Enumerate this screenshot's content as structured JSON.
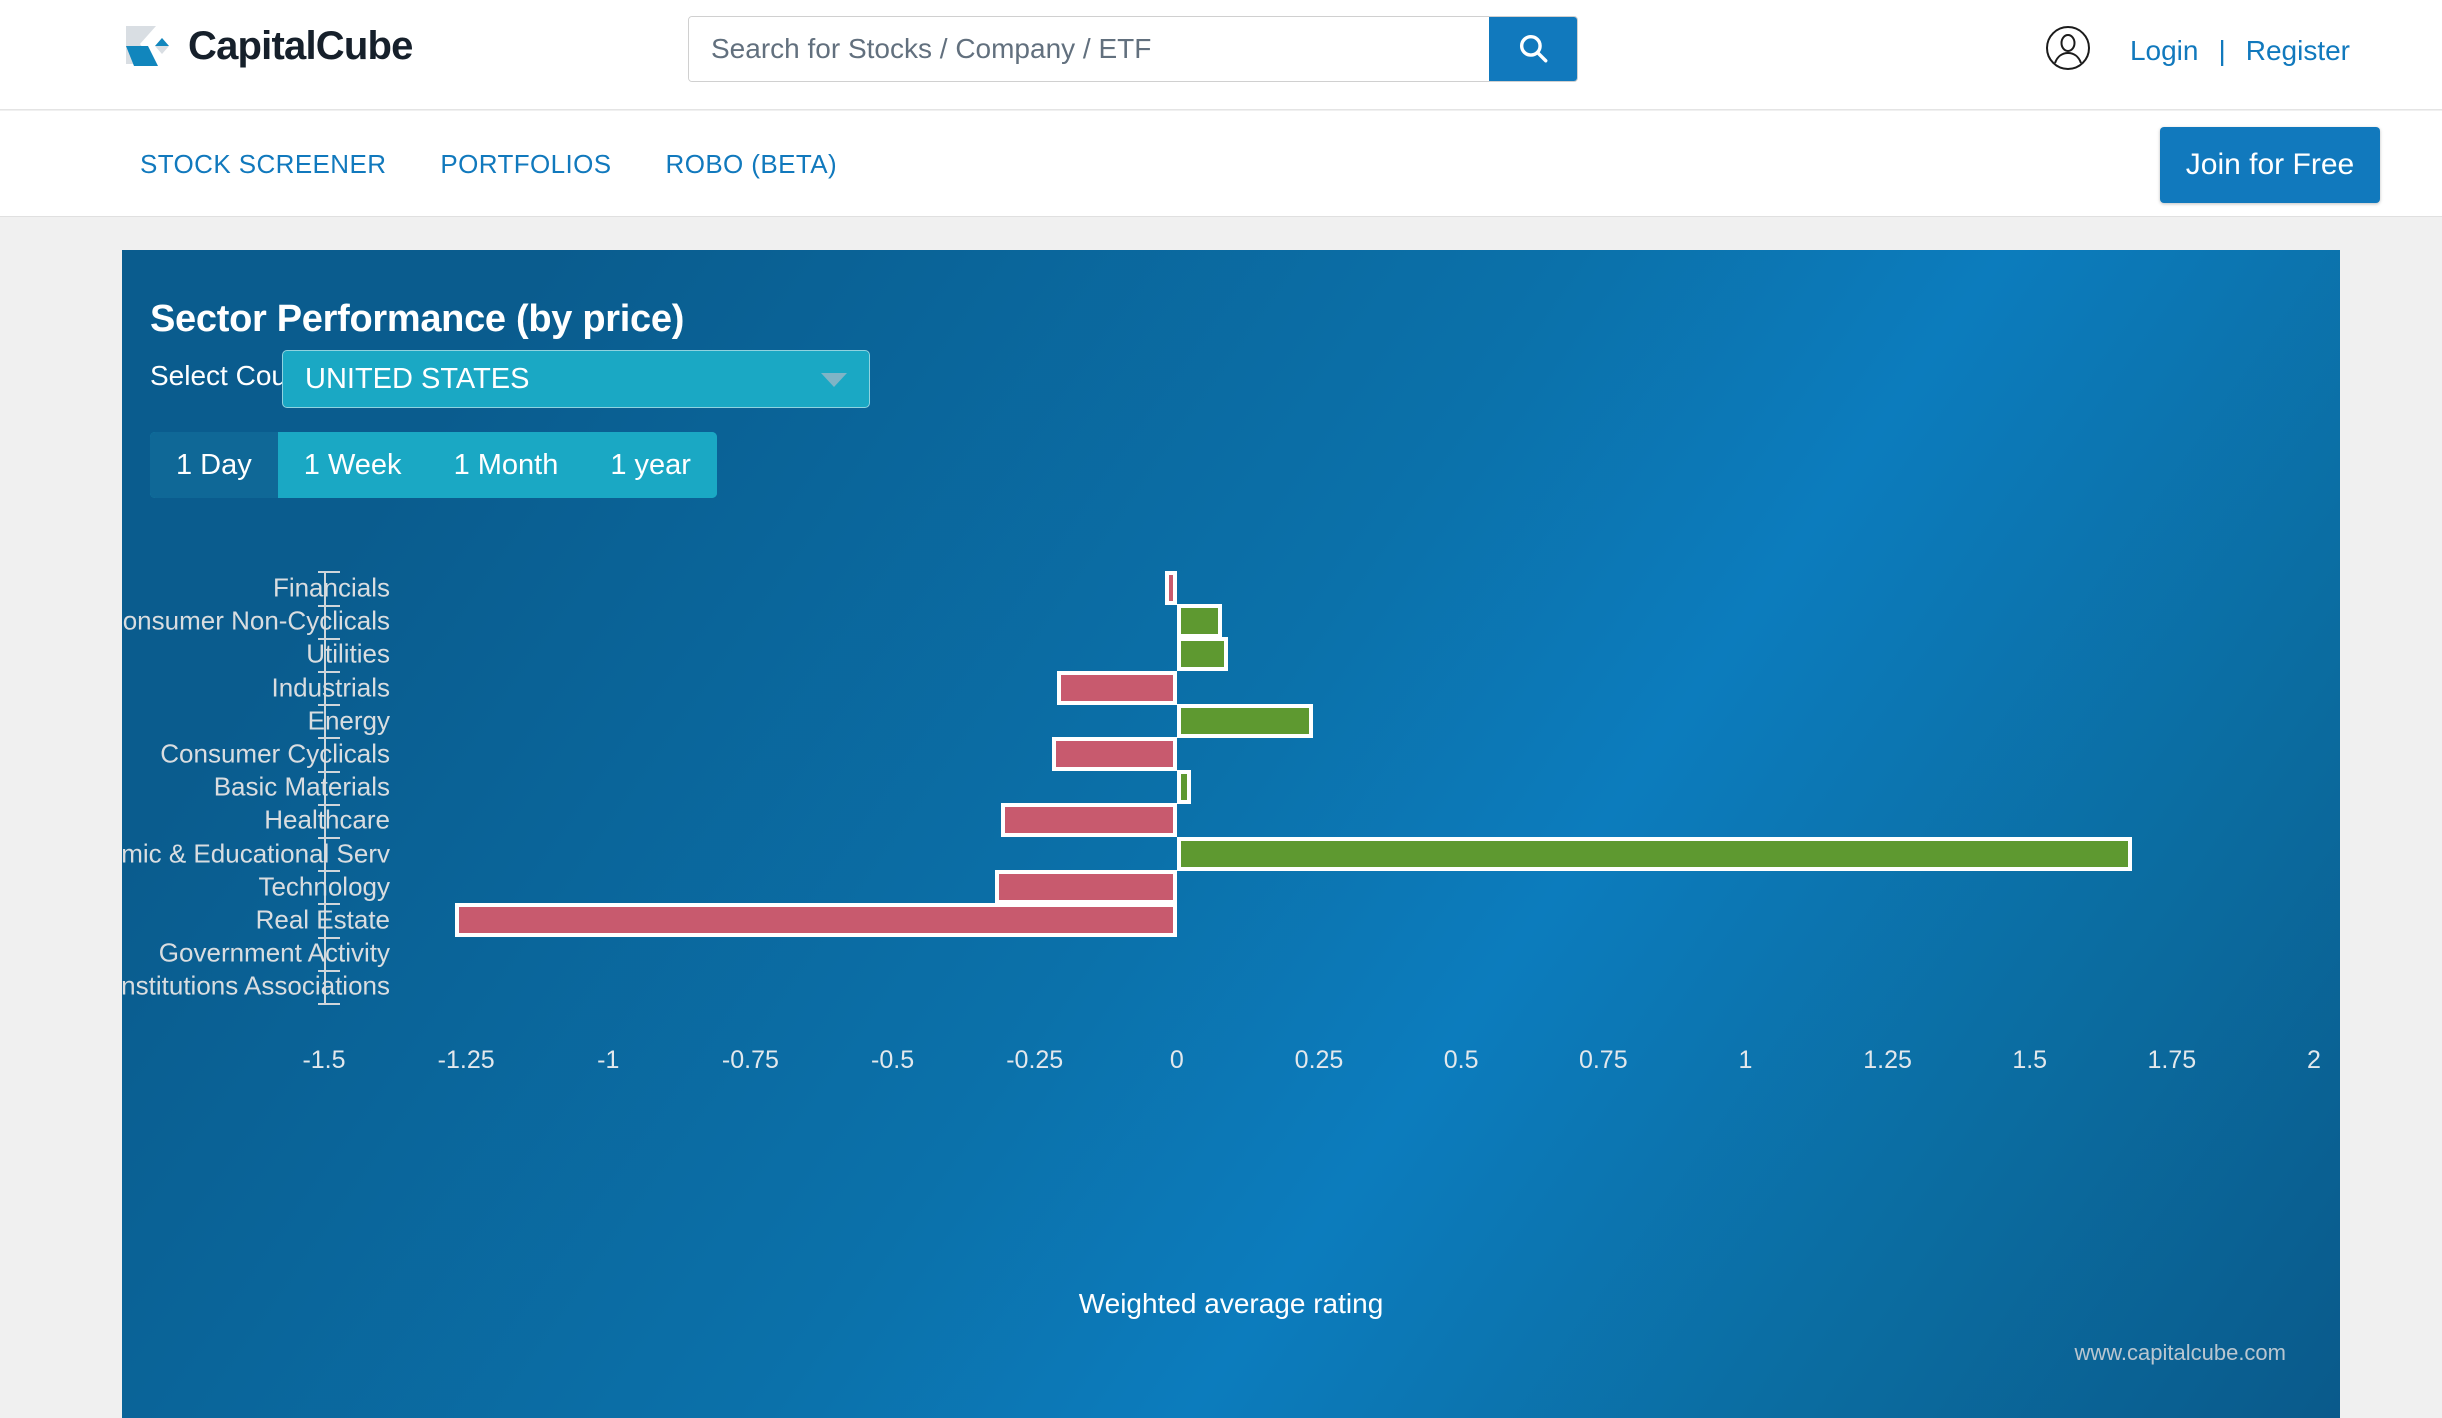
{
  "header": {
    "logo_text": "CapitalCube",
    "logo_icon": "capitalcube-logo-icon",
    "search": {
      "placeholder": "Search for Stocks / Company / ETF",
      "value": "",
      "button_icon": "search-icon"
    },
    "account": {
      "avatar_icon": "user-avatar-icon",
      "login_label": "Login",
      "separator": "|",
      "register_label": "Register"
    }
  },
  "nav": {
    "items": [
      {
        "label": "STOCK SCREENER"
      },
      {
        "label": "PORTFOLIOS"
      },
      {
        "label": "ROBO (BETA)"
      }
    ],
    "join_button_label": "Join for Free"
  },
  "panel": {
    "title": "Sector Performance (by price)",
    "country_label": "Select Country",
    "country_selected": "UNITED STATES",
    "country_caret_icon": "chevron-down-icon",
    "tabs": [
      {
        "label": "1 Day",
        "active": true
      },
      {
        "label": "1 Week",
        "active": false
      },
      {
        "label": "1 Month",
        "active": false
      },
      {
        "label": "1 year",
        "active": false
      }
    ],
    "watermark": "www.capitalcube.com"
  },
  "colors": {
    "brand_blue": "#1179bd",
    "panel_blue": "#0b71aa",
    "teal": "#1aa8c4",
    "tab_active": "#0f6897",
    "bar_up": "#5e9930",
    "bar_down": "#c85a6e",
    "bar_border": "#ffffff"
  },
  "chart_data": {
    "type": "bar",
    "orientation": "horizontal",
    "title": "Sector Performance (by price)",
    "xlabel": "Weighted average rating",
    "ylabel": "",
    "xlim": [
      -1.5,
      2
    ],
    "xticks": [
      -1.5,
      -1.25,
      -1,
      -0.75,
      -0.5,
      -0.25,
      0,
      0.25,
      0.5,
      0.75,
      1,
      1.25,
      1.5,
      1.75,
      2
    ],
    "xticklabels": [
      "-1.5",
      "-1.25",
      "-1",
      "-0.75",
      "-0.5",
      "-0.25",
      "0",
      "0.25",
      "0.5",
      "0.75",
      "1",
      "1.25",
      "1.5",
      "1.75",
      "2"
    ],
    "grid": false,
    "legend": false,
    "categories": [
      "Financials",
      "Consumer Non-Cyclicals",
      "Utilities",
      "Industrials",
      "Energy",
      "Consumer Cyclicals",
      "Basic Materials",
      "Healthcare",
      "Academic & Educational Serv",
      "Technology",
      "Real Estate",
      "Government Activity",
      "Institutions Associations"
    ],
    "values": [
      -0.02,
      0.08,
      0.09,
      -0.21,
      0.24,
      -0.22,
      0.025,
      -0.31,
      1.68,
      -0.32,
      -1.27,
      0,
      0
    ]
  }
}
